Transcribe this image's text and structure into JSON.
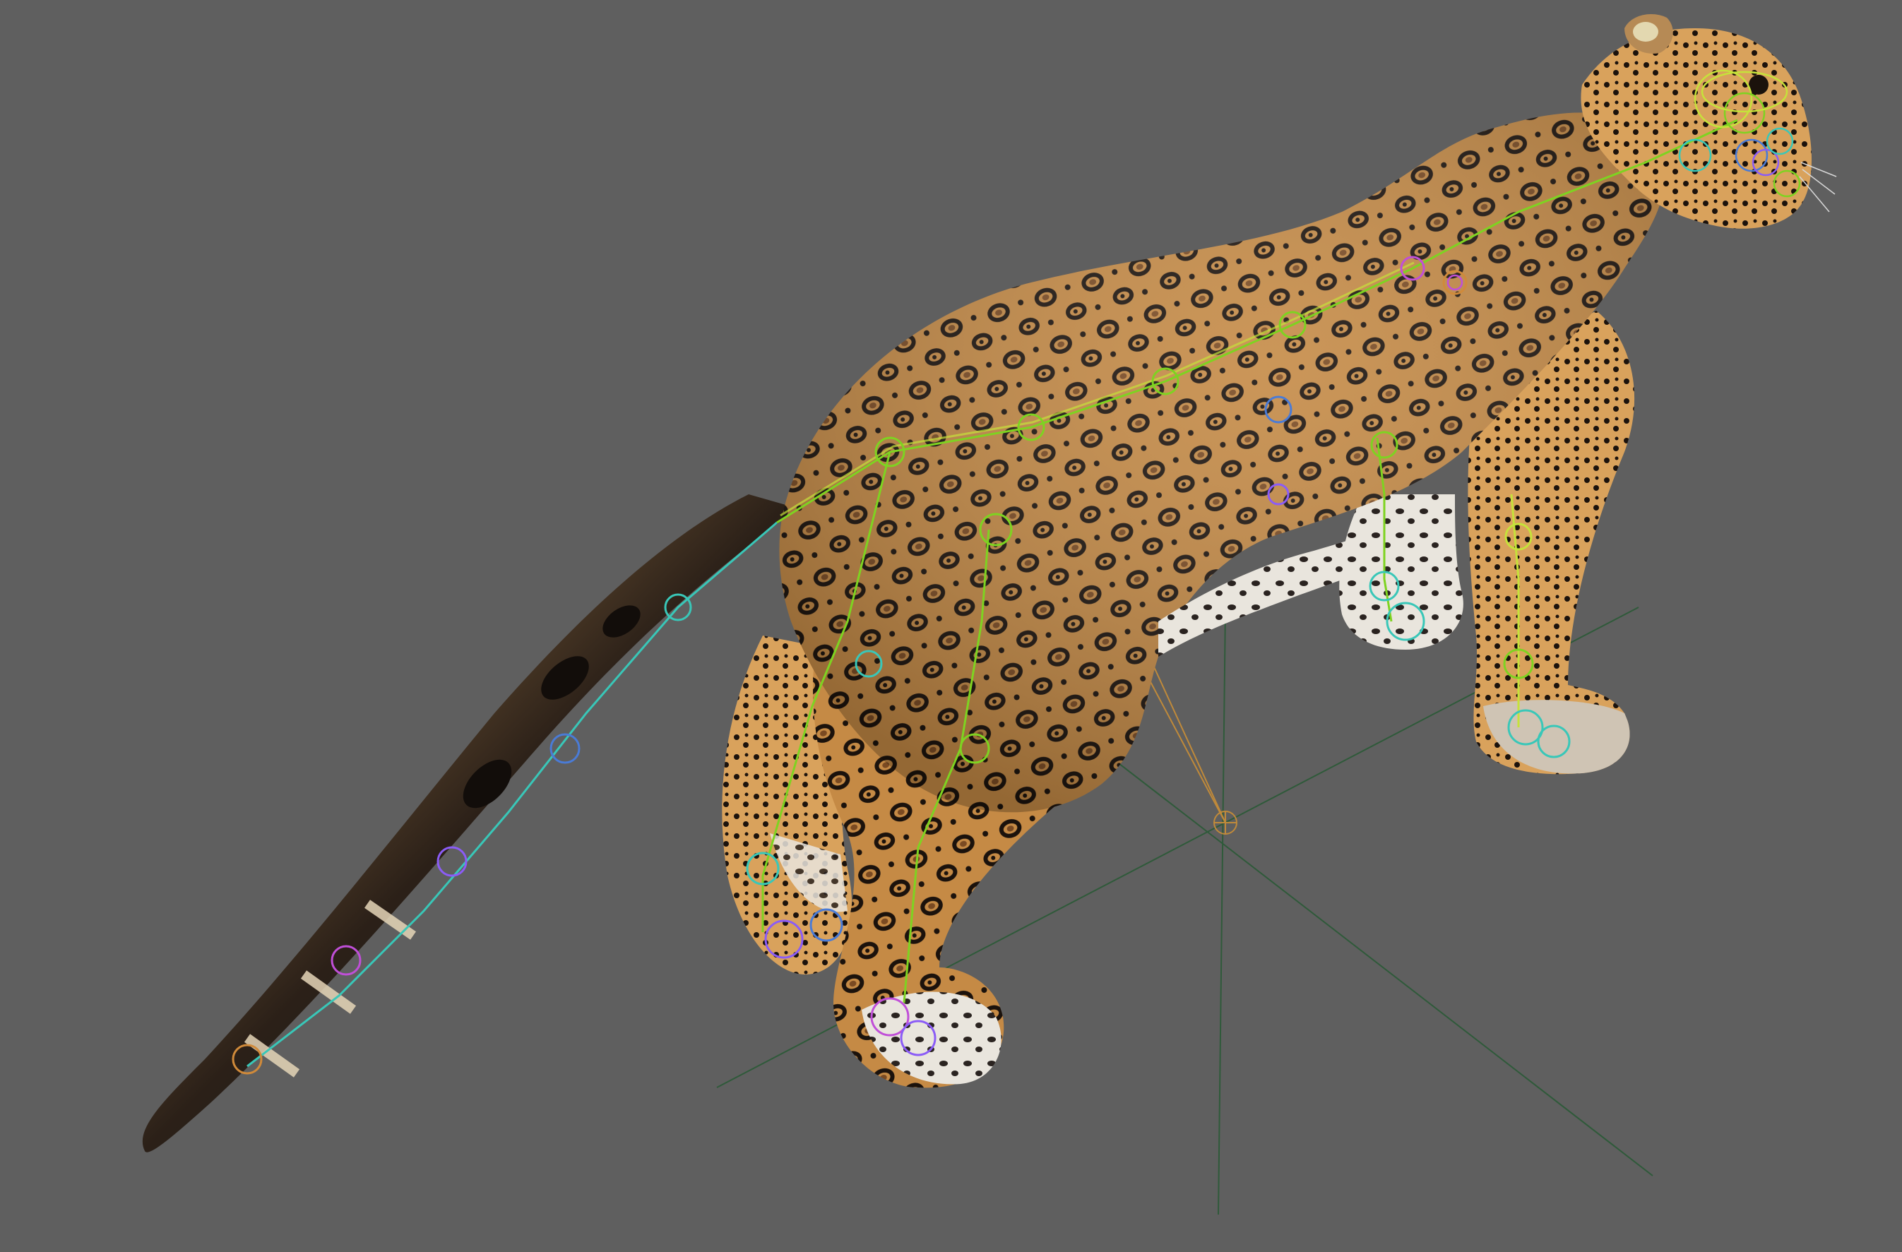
{
  "viewport": {
    "background": "#5f5f5f",
    "grid_color": "#2f5a3a",
    "pivot_color": "#c08a3a"
  },
  "model": {
    "subject": "jaguar",
    "fur_base": "#c58a45",
    "fur_light": "#e8c389",
    "spot_dark": "#1b120c",
    "belly_white": "#e9e5dd",
    "tail_dark": "#15110f"
  },
  "rig": {
    "bone_colors": [
      "#7ed321",
      "#39c7b8",
      "#8b5cf6",
      "#c04fd8",
      "#d08a3a",
      "#4a7bd6",
      "#c6e23a"
    ],
    "controls": [
      "spine",
      "neck",
      "head",
      "jaw",
      "tail",
      "front-leg-left",
      "front-leg-right",
      "hind-leg-left",
      "hind-leg-right"
    ]
  }
}
